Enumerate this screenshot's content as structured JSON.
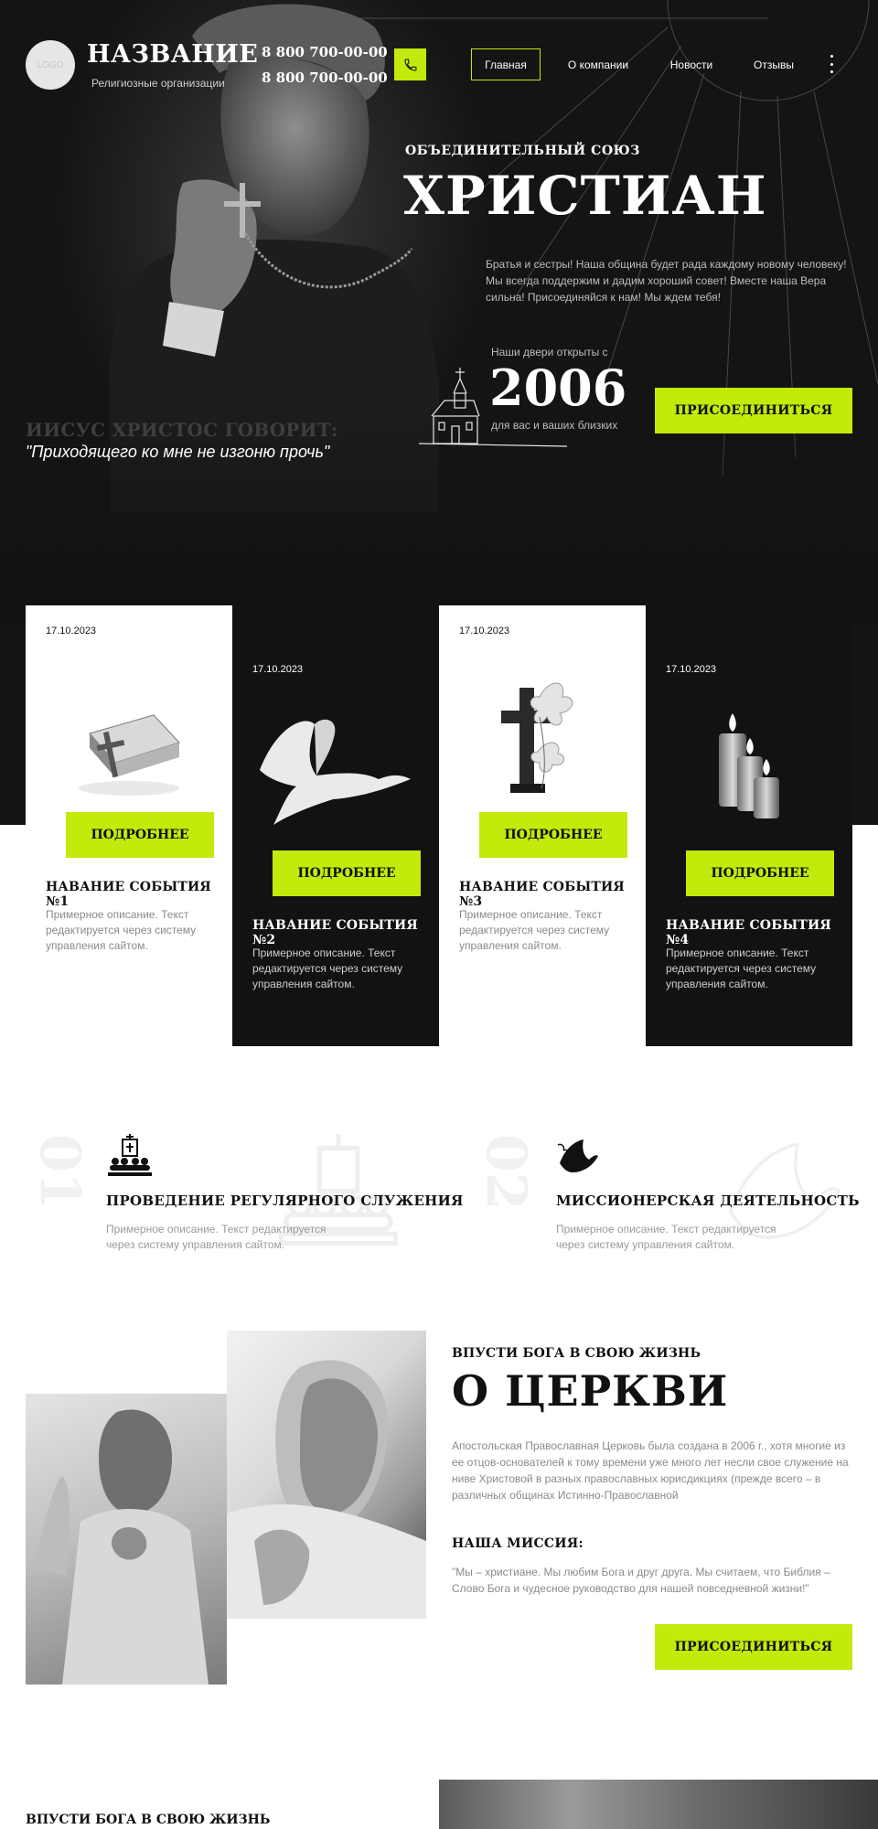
{
  "header": {
    "logo": "LOGO",
    "brand": "НАЗВАНИЕ",
    "brand_sub": "Религиозные организации",
    "phones": [
      "8 800 700-00-00",
      "8 800 700-00-00"
    ],
    "nav": [
      {
        "label": "Главная",
        "active": true
      },
      {
        "label": "О компании",
        "active": false
      },
      {
        "label": "Новости",
        "active": false
      },
      {
        "label": "Отзывы",
        "active": false
      }
    ]
  },
  "hero": {
    "kicker": "ОБЪЕДИНИТЕЛЬНЫЙ СОЮЗ",
    "title": "ХРИСТИАН",
    "description": "Братья и сестры!  Наша община будет рада каждому новому человеку! Мы всегда поддержим и дадим хороший совет! Вместе наша Вера сильна! Присоединяйся к нам! Мы ждем тебя!",
    "since_label": "Наши двери открыты с",
    "year": "2006",
    "since_sub": "для вас и ваших близких",
    "join_button": "ПРИСОЕДИНИТЬСЯ",
    "quote_head": "ИИСУС ХРИСТОС ГОВОРИТ:",
    "quote": "\"Приходящего ко мне не изгоню прочь\""
  },
  "events": [
    {
      "date": "17.10.2023",
      "title": "НАВАНИЕ СОБЫТИЯ №1",
      "description": "Примерное описание. Текст редактируется через систему управления сайтом.",
      "button": "ПОДРОБНЕЕ",
      "icon": "bible-cross-icon"
    },
    {
      "date": "17.10.2023",
      "title": "НАВАНИЕ СОБЫТИЯ №2",
      "description": "Примерное описание. Текст редактируется через систему управления сайтом.",
      "button": "ПОДРОБНЕЕ",
      "icon": "dove-icon"
    },
    {
      "date": "17.10.2023",
      "title": "НАВАНИЕ СОБЫТИЯ №3",
      "description": "Примерное описание. Текст редактируется через систему управления сайтом.",
      "button": "ПОДРОБНЕЕ",
      "icon": "cross-lily-icon"
    },
    {
      "date": "17.10.2023",
      "title": "НАВАНИЕ СОБЫТИЯ №4",
      "description": "Примерное описание. Текст редактируется через систему управления сайтом.",
      "button": "ПОДРОБНЕЕ",
      "icon": "candles-icon"
    }
  ],
  "services": [
    {
      "number": "01",
      "title": "ПРОВЕДЕНИЕ РЕГУЛЯРНОГО СЛУЖЕНИЯ",
      "description": "Примерное описание. Текст редактируется через систему управления сайтом.",
      "icon": "congregation-icon"
    },
    {
      "number": "02",
      "title": "МИССИОНЕРСКАЯ ДЕЯТЕЛЬНОСТЬ",
      "description": "Примерное описание. Текст редактируется через систему управления сайтом.",
      "icon": "dove-olive-icon"
    }
  ],
  "about": {
    "kicker": "ВПУСТИ БОГА В СВОЮ ЖИЗНЬ",
    "title": "О ЦЕРКВИ",
    "text": "Апостольская Православная Церковь была создана в 2006 г., хотя многие из ее отцов-основателей к тому времени уже много лет несли свое служение на ниве Христовой в разных православных юрисдикциях (прежде всего – в различных общинах Истинно-Православной",
    "mission_head": "НАША МИССИЯ:",
    "mission_text": "\"Мы – христиане. Мы любим Бога и друг друга. Мы считаем, что Библия – Слово Бога и чудесное руководство для нашей повседневной жизни!\"",
    "join_button": "ПРИСОЕДИНИТЬСЯ"
  },
  "bottom": {
    "kicker": "ВПУСТИ БОГА В СВОЮ ЖИЗНЬ"
  },
  "colors": {
    "accent": "#c2ea0a",
    "dark": "#121212",
    "muted": "#8a8a8a"
  }
}
